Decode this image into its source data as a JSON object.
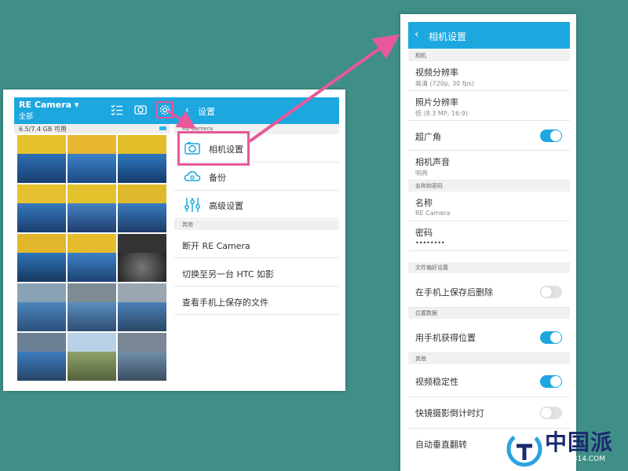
{
  "colors": {
    "background": "#3f8f88",
    "accent": "#1da7df",
    "highlight": "#e8589a",
    "toggle_on": "#1da7df",
    "toggle_off": "#e2e2e2"
  },
  "left": {
    "app_title": "RE Camera ▾",
    "app_subtitle": "全部",
    "toolbar_icons": [
      "list-check-icon",
      "camera-icon",
      "gear-icon"
    ],
    "storage": "6.5/7.4 GB 可用",
    "settings_title": "设置",
    "section_re_camera": "RE Camera",
    "menu": [
      {
        "label": "相机设置",
        "icon": "camera-icon"
      },
      {
        "label": "备份",
        "icon": "cloud-icon"
      },
      {
        "label": "高级设置",
        "icon": "sliders-icon"
      }
    ],
    "section_other": "其他",
    "other_items": [
      {
        "label": "断开 RE Camera"
      },
      {
        "label": "切换至另一台 HTC 如影"
      },
      {
        "label": "查看手机上保存的文件"
      }
    ]
  },
  "right": {
    "title": "相机设置",
    "section_camera": "相机",
    "video_resolution": {
      "label": "视频分辨率",
      "value": "高清 (720p, 30 fps)"
    },
    "photo_resolution": {
      "label": "照片分辨率",
      "value": "低 (8.3 MP, 16:9)"
    },
    "wide_angle": {
      "label": "超广角",
      "on": true
    },
    "camera_sound": {
      "label": "相机声音",
      "value": "响亮"
    },
    "section_name_password": "名称和密码",
    "name": {
      "label": "名称",
      "value": "RE Camera"
    },
    "password": {
      "label": "密码",
      "value": "••••••••"
    },
    "section_file_pref": "文件偏好设置",
    "delete_after_save": {
      "label": "在手机上保存后删除",
      "on": false
    },
    "section_location": "位置数据",
    "use_phone_location": {
      "label": "用手机获得位置",
      "on": true
    },
    "section_other": "其他",
    "video_stabilization": {
      "label": "视频稳定性",
      "on": true
    },
    "timelapse_countdown": {
      "label": "快镜摄影倒计时灯",
      "on": false
    },
    "auto_flip": {
      "label": "自动垂直翻转"
    }
  },
  "watermark": {
    "text": "中国派",
    "url": "BBS.CN314.COM"
  }
}
